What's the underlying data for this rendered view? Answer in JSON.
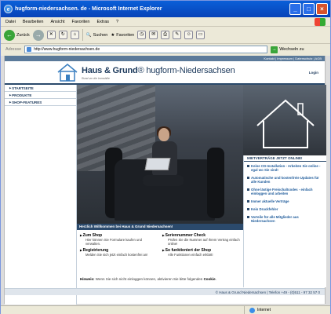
{
  "browser": {
    "title": "hugform-niedersachsen. de - Microsoft Internet Explorer",
    "menu": [
      "Datei",
      "Bearbeiten",
      "Ansicht",
      "Favoriten",
      "Extras",
      "?"
    ],
    "toolbar": {
      "back": "Zurück",
      "search": "Suchen",
      "favorites": "Favoriten"
    },
    "address_label": "Adresse",
    "url": "http://www.hugform-niedersachsen.de",
    "go_label": "Wechseln zu",
    "status_zone": "Internet"
  },
  "site": {
    "toplinks": "Kontakt | Impressum | Datenschutz | AGB",
    "logo_brand": "Haus & Grund",
    "logo_name": "hugform-Niedersachsen",
    "tagline": "Rund um die Immobilie",
    "login": "Login",
    "nav": [
      "STARTSEITE",
      "PRODUKTE",
      "SHOP-FEATURES"
    ],
    "welcome": "Herzlich Willkommen bei Haus & Grund Niedersachsen!",
    "features": [
      {
        "title": "Zum Shop",
        "desc": "Hier können Sie Formulare kaufen und verwalten."
      },
      {
        "title": "Seriennummer Check",
        "desc": "Prüfen Sie die Nummer auf Ihrem Vertrag einfach online!"
      },
      {
        "title": "Registrierung",
        "desc": "Melden Sie sich jetzt einfach kostenfrei an!"
      },
      {
        "title": "So funktioniert der Shop",
        "desc": "Alle Funktionen einfach erklärt!"
      }
    ],
    "hint_label": "Hinweis:",
    "hint_text": "Wenn Sie sich nicht einloggen können, aktivieren Sie bitte folgenden",
    "hint_cookie": "Cookie",
    "sidebar_title": "MIETVERTRÄGE JETZT ONLINE!",
    "sidebar_items": [
      "Keine CD-Installation - Arbeiten Sie online - egal wo Sie sind!",
      "Automatische und kostenfreie Updates für alle Kunden",
      "Ohne lästige Freischaltcodes - einfach einloggen und arbeiten",
      "Immer aktuelle Verträge",
      "Kein Druckfehler",
      "Vorteile für alle Mitglieder aus Niedersachsen"
    ],
    "footer": "© Haus & Grund Niedersachsen | Telefon +49 - (0)511 - 97 32 57 0"
  }
}
